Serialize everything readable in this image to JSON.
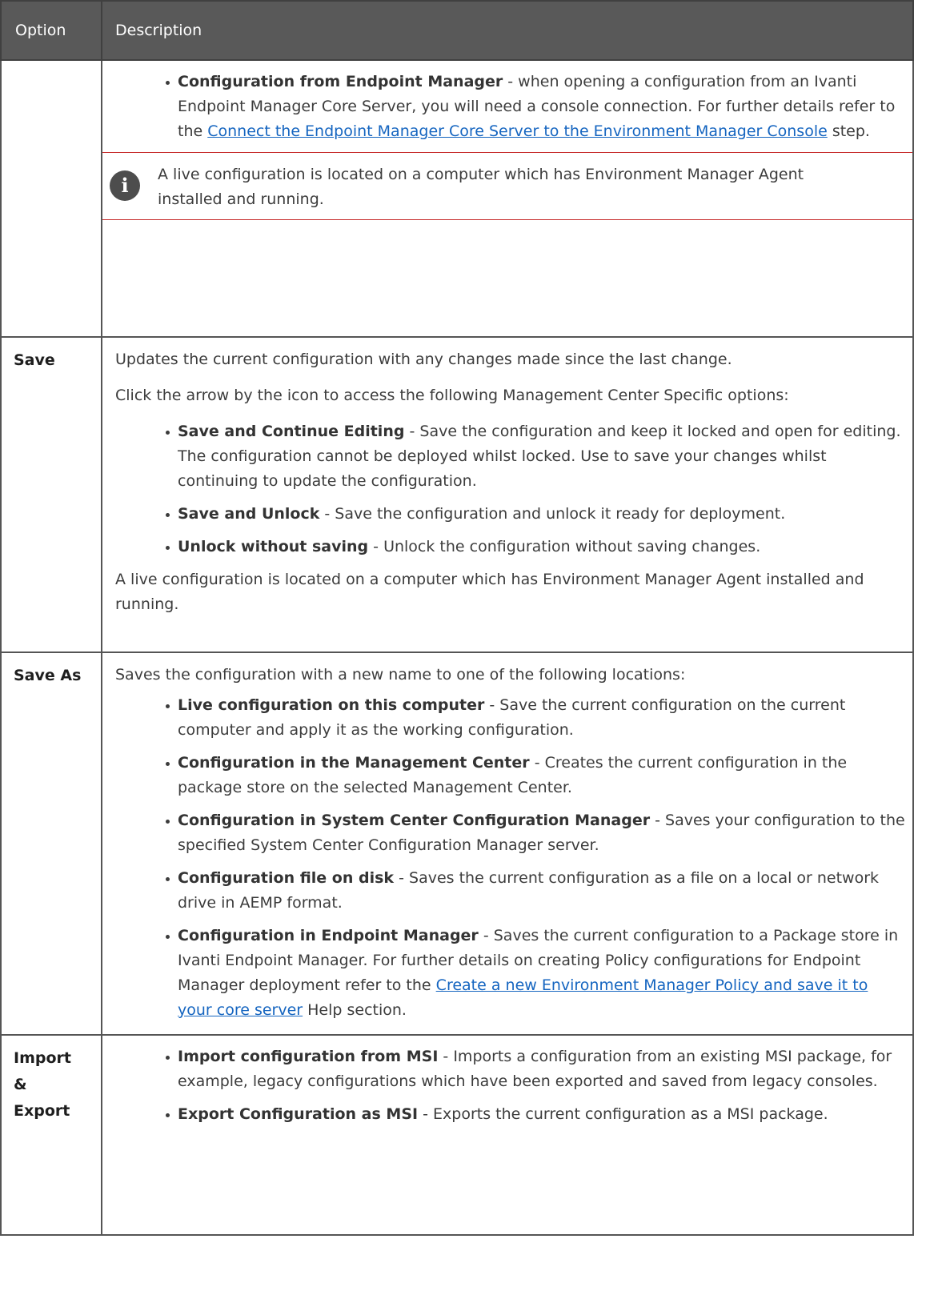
{
  "header": {
    "option": "Option",
    "description": "Description"
  },
  "row1": {
    "bullet": {
      "bold": "Configuration from Endpoint Manager",
      "text": " - when opening a configuration from an Ivanti Endpoint Manager Core Server, you will need a console connection. For further details refer to the ",
      "link": "Connect the Endpoint Manager Core Server to the Environment Manager Console",
      "after": " step."
    },
    "note": {
      "icon": "i",
      "text": "A live configuration is located on a computer which has Environment Manager Agent installed and running."
    }
  },
  "save": {
    "option": "Save",
    "intro": "Updates the current configuration with any changes made since the last change.",
    "click": "Click the arrow by the icon to access the following Management Center Specific options:",
    "bullets": [
      {
        "bold": "Save and Continue Editing",
        "text": " - Save the configuration and keep it locked and open for editing. The configuration cannot be deployed whilst locked. Use to save your changes whilst continuing to update the configuration."
      },
      {
        "bold": "Save and Unlock",
        "text": " - Save the configuration and unlock it ready for deployment."
      },
      {
        "bold": "Unlock without saving",
        "text": " - Unlock the configuration without saving changes."
      }
    ],
    "footer": "A live configuration is located on a computer which has Environment Manager Agent installed and running."
  },
  "saveas": {
    "option": "Save As",
    "intro": "Saves the configuration with a new name to one of the following locations:",
    "bullets": [
      {
        "bold": "Live configuration on this computer",
        "text": " - Save the current configuration on the current computer and apply it as the working configuration."
      },
      {
        "bold": "Configuration in the Management Center",
        "text": " - Creates the current configuration in the package store on the selected Management Center."
      },
      {
        "bold": "Configuration in System Center Configuration Manager",
        "text": " - Saves your configuration to the specified System Center Configuration Manager server."
      },
      {
        "bold": "Configuration file on disk",
        "text": " - Saves the current configuration as a file on a local or network drive in AEMP format."
      }
    ],
    "last": {
      "bold": "Configuration in Endpoint Manager",
      "text": " - Saves the current configuration to a Package store in Ivanti Endpoint Manager. For further details on creating Policy configurations for Endpoint Manager deployment refer to the ",
      "link": "Create a new Environment Manager Policy and save it to your core server",
      "after": " Help section."
    }
  },
  "importexport": {
    "option_lines": [
      "Import",
      "&",
      "Export"
    ],
    "bullets": [
      {
        "bold": "Import configuration from MSI",
        "text": " - Imports a configuration from an existing MSI package, for example, legacy configurations which have been exported and saved from legacy consoles."
      },
      {
        "bold": "Export Configuration as MSI",
        "text": " - Exports the current configuration as a MSI package."
      }
    ]
  }
}
